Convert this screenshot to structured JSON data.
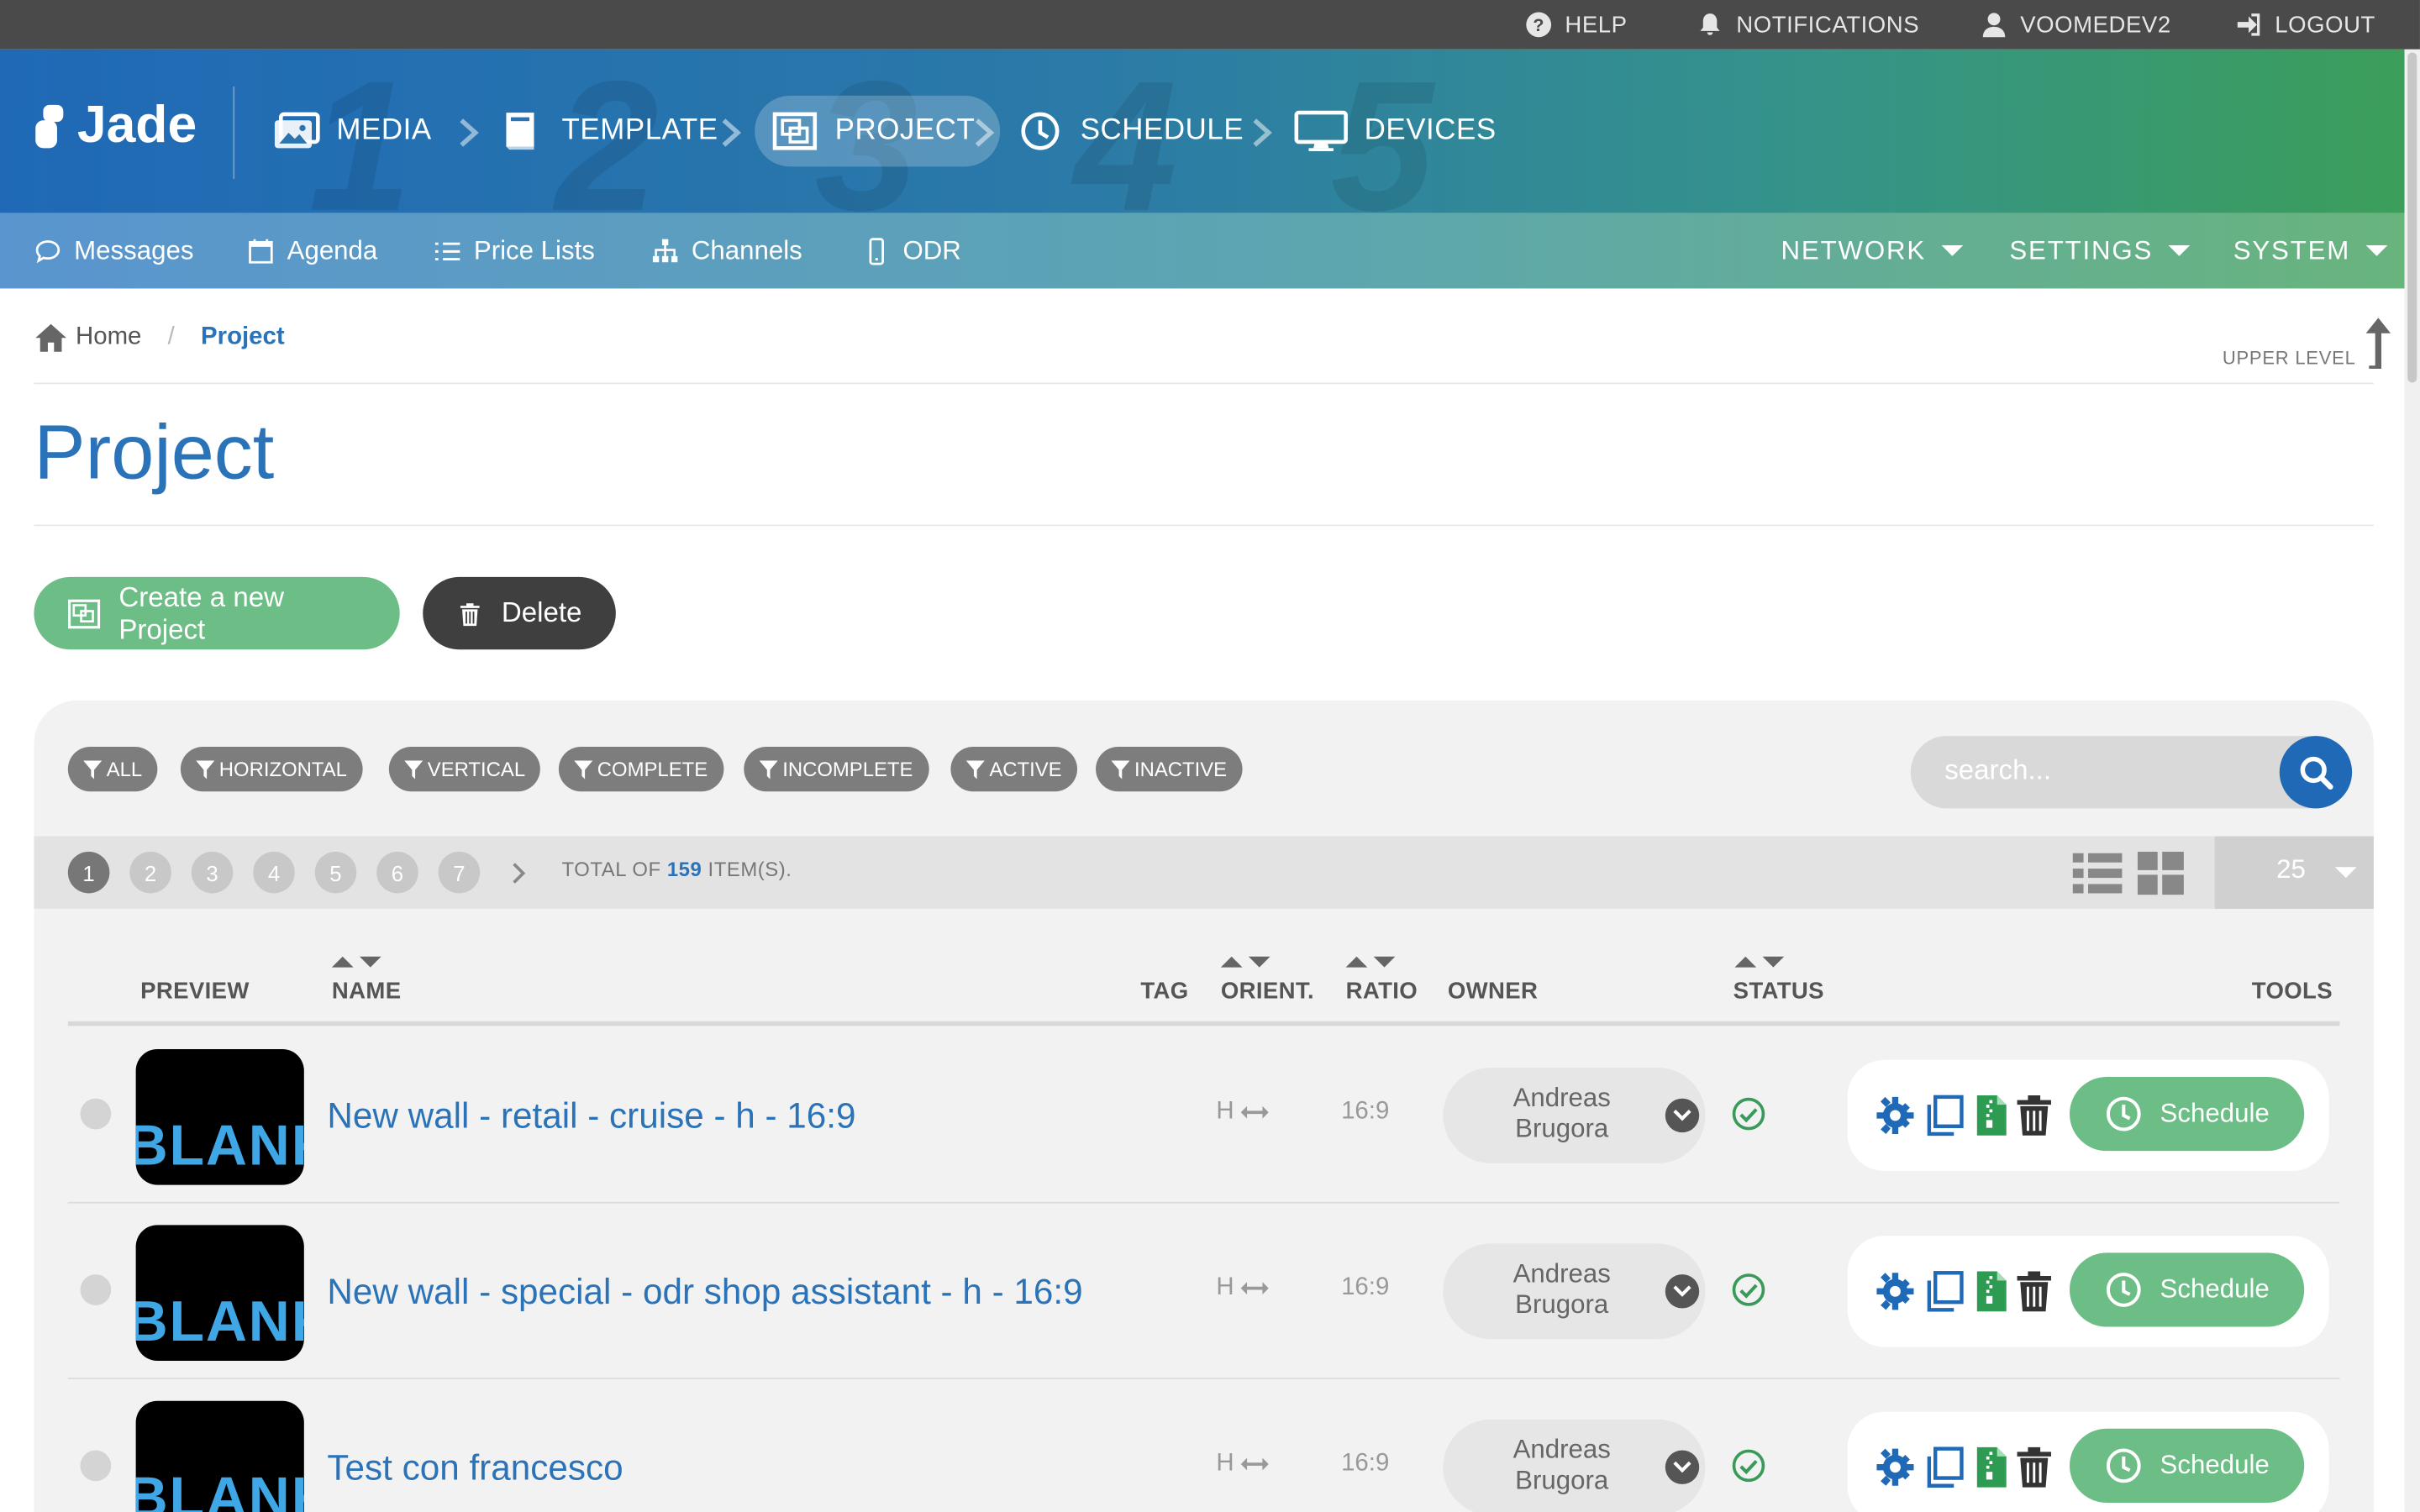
{
  "topbar": {
    "help": "HELP",
    "notifications": "NOTIFICATIONS",
    "user": "VOOMEDEV2",
    "logout": "LOGOUT"
  },
  "header": {
    "logo": "Jade",
    "steps": [
      {
        "label": "MEDIA",
        "icon": "media-icon"
      },
      {
        "label": "TEMPLATE",
        "icon": "template-icon"
      },
      {
        "label": "PROJECT",
        "icon": "project-icon",
        "active": true
      },
      {
        "label": "SCHEDULE",
        "icon": "clock-icon"
      },
      {
        "label": "DEVICES",
        "icon": "monitor-icon"
      }
    ],
    "step_numbers": [
      "1",
      "2",
      "3",
      "4",
      "5"
    ]
  },
  "subnav": {
    "left": [
      "Messages",
      "Agenda",
      "Price Lists",
      "Channels",
      "ODR"
    ],
    "right": [
      "NETWORK",
      "SETTINGS",
      "SYSTEM"
    ]
  },
  "breadcrumb": {
    "home": "Home",
    "current": "Project",
    "upper_level": "UPPER LEVEL"
  },
  "page_title": "Project",
  "actions": {
    "create": "Create a new Project",
    "delete": "Delete"
  },
  "filters": [
    "ALL",
    "HORIZONTAL",
    "VERTICAL",
    "COMPLETE",
    "INCOMPLETE",
    "ACTIVE",
    "INACTIVE"
  ],
  "search": {
    "placeholder": "search..."
  },
  "pagination": {
    "pages": [
      "1",
      "2",
      "3",
      "4",
      "5",
      "6",
      "7"
    ],
    "current": "1",
    "total_prefix": "TOTAL OF",
    "total": "159",
    "total_suffix": "ITEM(S).",
    "per_page": "25"
  },
  "table": {
    "headers": {
      "preview": "PREVIEW",
      "name": "NAME",
      "tag": "TAG",
      "orient": "ORIENT.",
      "ratio": "RATIO",
      "owner": "OWNER",
      "status": "STATUS",
      "tools": "TOOLS"
    },
    "rows": [
      {
        "thumb": "BLANK",
        "name": "New wall - retail - cruise - h - 16:9",
        "orient": "H",
        "ratio": "16:9",
        "owner_first": "Andreas",
        "owner_last": "Brugora",
        "schedule": "Schedule"
      },
      {
        "thumb": "BLANK",
        "name": "New wall - special - odr shop assistant - h - 16:9",
        "orient": "H",
        "ratio": "16:9",
        "owner_first": "Andreas",
        "owner_last": "Brugora",
        "schedule": "Schedule"
      },
      {
        "thumb": "BLANK",
        "name": "Test con francesco",
        "orient": "H",
        "ratio": "16:9",
        "owner_first": "Andreas",
        "owner_last": "Brugora",
        "schedule": "Schedule"
      }
    ]
  },
  "colors": {
    "primary": "#1f69b6",
    "green": "#6dbd87",
    "dark": "#4a4a4a",
    "link": "#2b73b8"
  }
}
